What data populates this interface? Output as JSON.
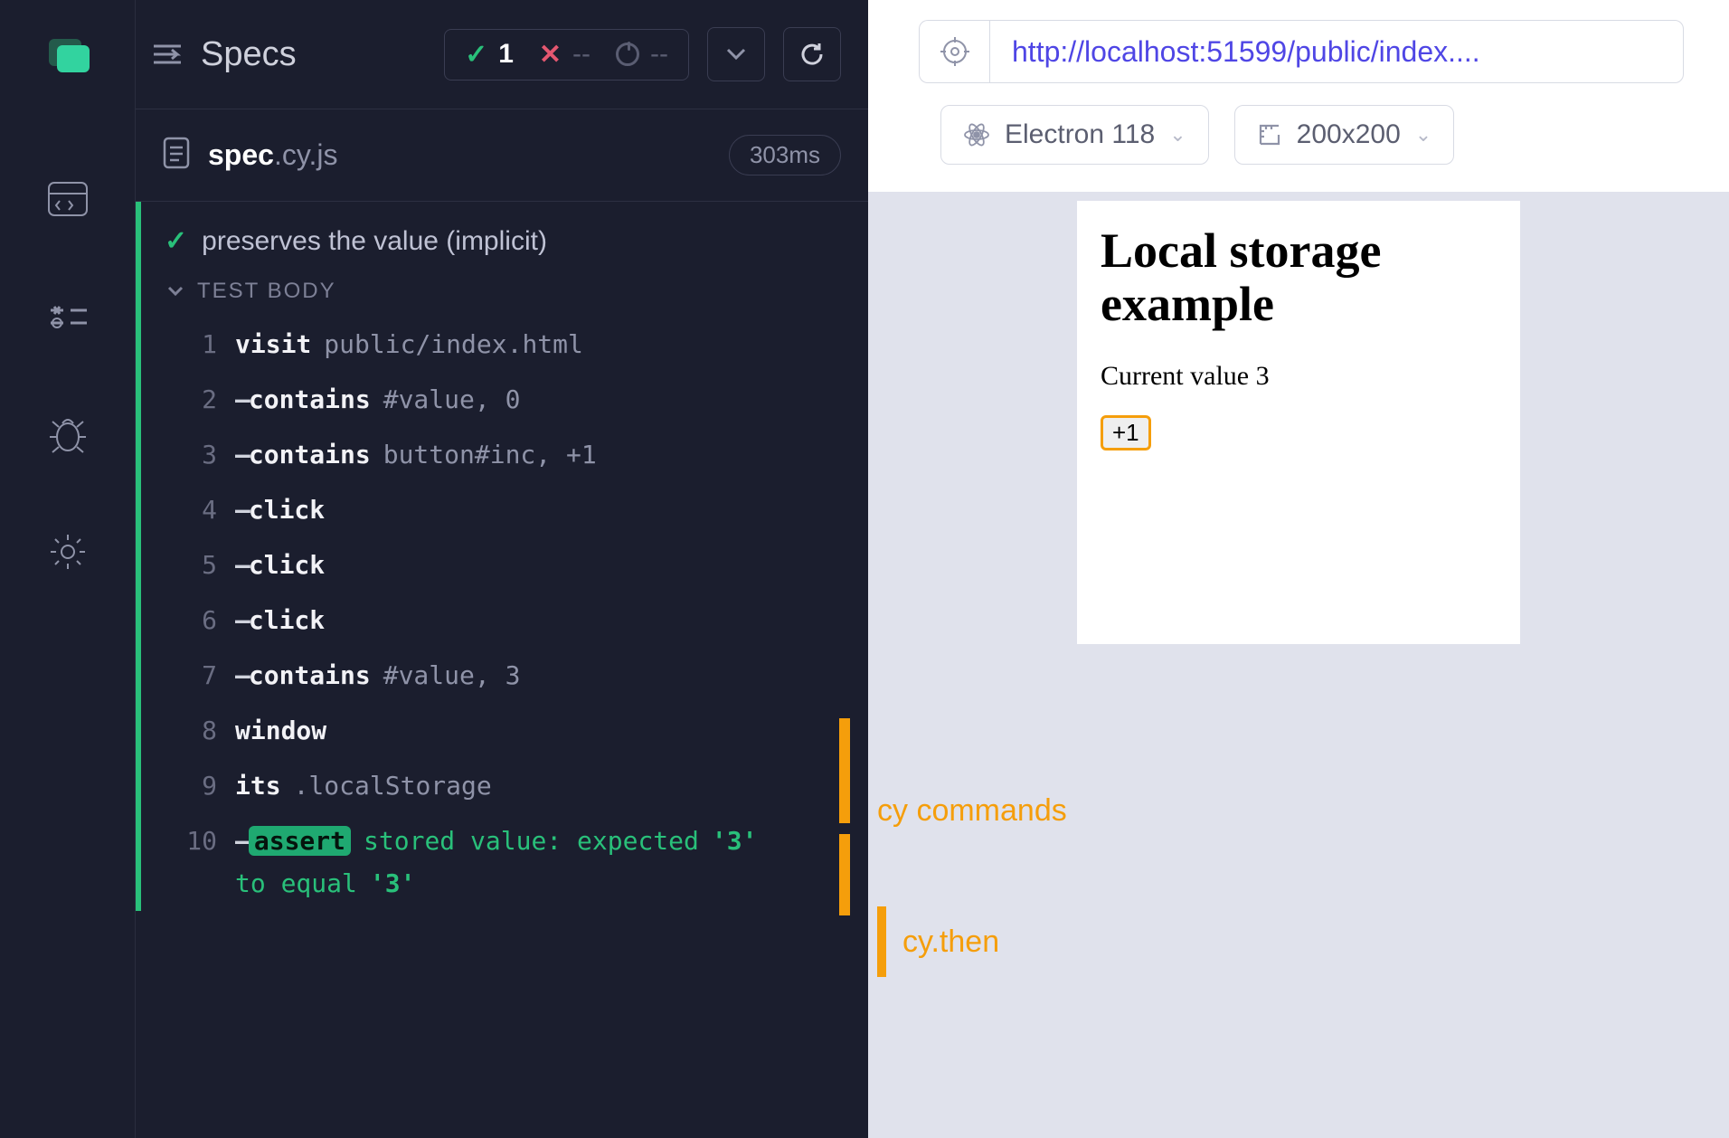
{
  "header": {
    "title": "Specs",
    "passed": "1",
    "failed": "--",
    "pending": "--"
  },
  "spec": {
    "name": "spec",
    "ext": ".cy.js",
    "duration": "303ms"
  },
  "test": {
    "title": "preserves the value (implicit)",
    "body_label": "TEST BODY"
  },
  "commands": [
    {
      "n": "1",
      "cmd": "visit",
      "arg": "public/index.html",
      "child": false
    },
    {
      "n": "2",
      "cmd": "contains",
      "arg": "#value, 0",
      "child": true
    },
    {
      "n": "3",
      "cmd": "contains",
      "arg": "button#inc, +1",
      "child": true
    },
    {
      "n": "4",
      "cmd": "click",
      "arg": "",
      "child": true
    },
    {
      "n": "5",
      "cmd": "click",
      "arg": "",
      "child": true
    },
    {
      "n": "6",
      "cmd": "click",
      "arg": "",
      "child": true
    },
    {
      "n": "7",
      "cmd": "contains",
      "arg": "#value, 3",
      "child": true
    },
    {
      "n": "8",
      "cmd": "window",
      "arg": "",
      "child": false
    },
    {
      "n": "9",
      "cmd": "its",
      "arg": ".localStorage",
      "child": false
    }
  ],
  "assertion": {
    "n": "10",
    "label": "assert",
    "msg_a": "stored value: expected",
    "val_a": "'3'",
    "msg_b": "to equal",
    "val_b": "'3'"
  },
  "preview": {
    "url": "http://localhost:51599/public/index....",
    "browser": "Electron 118",
    "viewport": "200x200",
    "aut_title": "Local storage example",
    "aut_current_prefix": "Current value ",
    "aut_current_value": "3",
    "aut_button": "+1",
    "annot1": "cy commands",
    "annot2": "cy.then"
  }
}
